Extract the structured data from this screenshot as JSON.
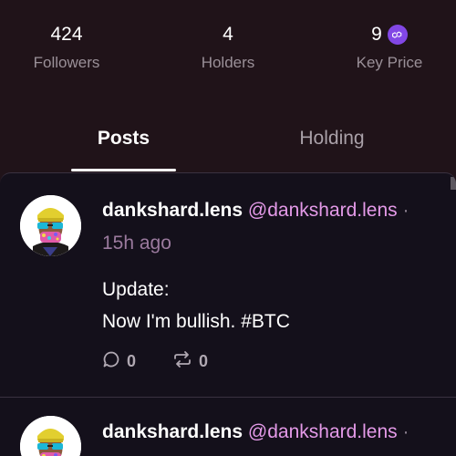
{
  "stats": [
    {
      "value": "424",
      "label": "Followers"
    },
    {
      "value": "4",
      "label": "Holders"
    },
    {
      "value": "9",
      "label": "Key Price",
      "icon": "polygon-token-icon",
      "icon_color": "#8247e5"
    }
  ],
  "tabs": [
    {
      "label": "Posts",
      "active": true
    },
    {
      "label": "Holding",
      "active": false
    }
  ],
  "posts": [
    {
      "author": "dankshard.lens",
      "handle": "@dankshard.lens",
      "separator": "·",
      "time": "15h ago",
      "text_lines": [
        "Update:",
        "Now I'm bullish. #BTC"
      ],
      "comments": "0",
      "mirrors": "0"
    },
    {
      "author": "dankshard.lens",
      "handle": "@dankshard.lens",
      "separator": "·"
    }
  ],
  "colors": {
    "background": "#201319",
    "feed_background": "#14101b",
    "handle": "#e49ae8",
    "muted": "#9a9098",
    "token": "#8247e5"
  }
}
